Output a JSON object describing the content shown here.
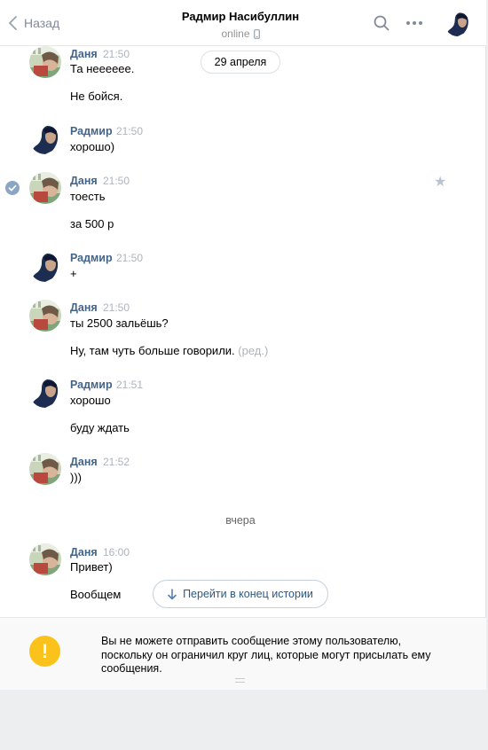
{
  "header": {
    "back_label": "Назад",
    "title": "Радмир Насибуллин",
    "status": "online"
  },
  "date_pill": "29 апреля",
  "messages": [
    {
      "author": "Даня",
      "time": "21:50",
      "lines": [
        "Та нееееее.",
        "Не бойся."
      ]
    },
    {
      "author": "Радмир",
      "time": "21:50",
      "lines": [
        "хорошо)"
      ]
    },
    {
      "author": "Даня",
      "time": "21:50",
      "lines": [
        "тоесть",
        "за 500 р"
      ]
    },
    {
      "author": "Радмир",
      "time": "21:50",
      "lines": [
        "+"
      ]
    },
    {
      "author": "Даня",
      "time": "21:50",
      "lines": [
        "ты 2500 зальёшь?",
        "Ну, там чуть больше говорили."
      ],
      "edited": "(ред.)"
    },
    {
      "author": "Радмир",
      "time": "21:51",
      "lines": [
        "хорошо",
        "буду ждать"
      ]
    },
    {
      "author": "Даня",
      "time": "21:52",
      "lines": [
        ")))"
      ]
    },
    {
      "author": "Даня",
      "time": "16:00",
      "lines": [
        "Привет)",
        "Вообщем"
      ]
    }
  ],
  "day_separator": "вчера",
  "jump_button": "Перейти в конец истории",
  "notice": {
    "icon": "!",
    "text": "Вы не можете отправить сообщение этому пользователю, поскольку он ограничил круг лиц, которые могут присылать ему сообщения."
  },
  "colors": {
    "accent": "#42648b",
    "link": "#2a5885",
    "warning": "#fbc21c",
    "muted": "#adb4be"
  }
}
